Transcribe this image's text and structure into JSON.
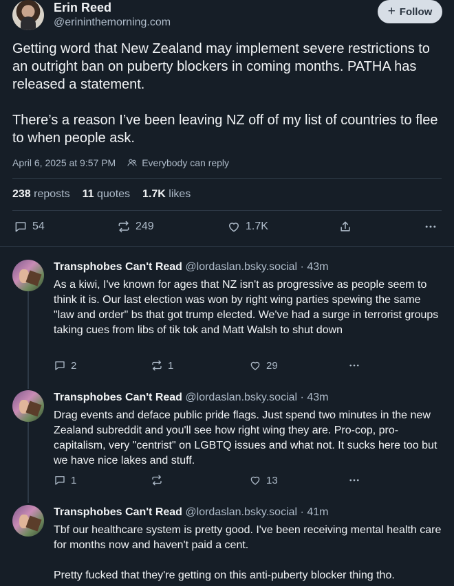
{
  "post": {
    "author_name": "Erin Reed",
    "author_handle": "@erininthemorning.com",
    "follow_label": "Follow",
    "paragraphs": [
      "Getting word that New Zealand may implement severe restrictions to an outright ban on puberty blockers in coming months. PATHA has released a statement.",
      "There’s a reason I’ve been leaving NZ off of my list of countries to flee to when people ask."
    ],
    "timestamp": "April 6, 2025 at 9:57 PM",
    "reply_setting": "Everybody can reply",
    "stats": {
      "reposts_count": "238",
      "reposts_label": "reposts",
      "quotes_count": "11",
      "quotes_label": "quotes",
      "likes_count": "1.7K",
      "likes_label": "likes"
    },
    "actions": {
      "replies": "54",
      "reposts": "249",
      "likes": "1.7K"
    }
  },
  "replies": [
    {
      "name": "Transphobes Can't Read",
      "handle": "@lordaslan.bsky.social",
      "time": "43m",
      "paragraphs": [
        "As a kiwi, I've known for ages that NZ isn't as progressive as people seem to think it is. Our last election was won by right wing parties spewing the same \"law and order\" bs that got trump elected. We've had a surge in terrorist groups taking cues from libs of tik tok and Matt Walsh to shut down"
      ],
      "replies": "2",
      "reposts": "1",
      "likes": "29"
    },
    {
      "name": "Transphobes Can't Read",
      "handle": "@lordaslan.bsky.social",
      "time": "43m",
      "paragraphs": [
        "Drag events and deface public pride flags. Just spend two minutes in the new Zealand subreddit and you'll see how right wing they are. Pro-cop, pro-capitalism, very \"centrist\" on LGBTQ issues and what not. It sucks here too but we have nice lakes and stuff."
      ],
      "replies": "1",
      "reposts": "",
      "likes": "13"
    },
    {
      "name": "Transphobes Can't Read",
      "handle": "@lordaslan.bsky.social",
      "time": "41m",
      "paragraphs": [
        "Tbf our healthcare system is pretty good. I've been receiving mental health care for months now and haven't paid a cent.",
        "Pretty fucked that they're getting on this anti-puberty blocker thing tho."
      ]
    }
  ],
  "separator": "·"
}
